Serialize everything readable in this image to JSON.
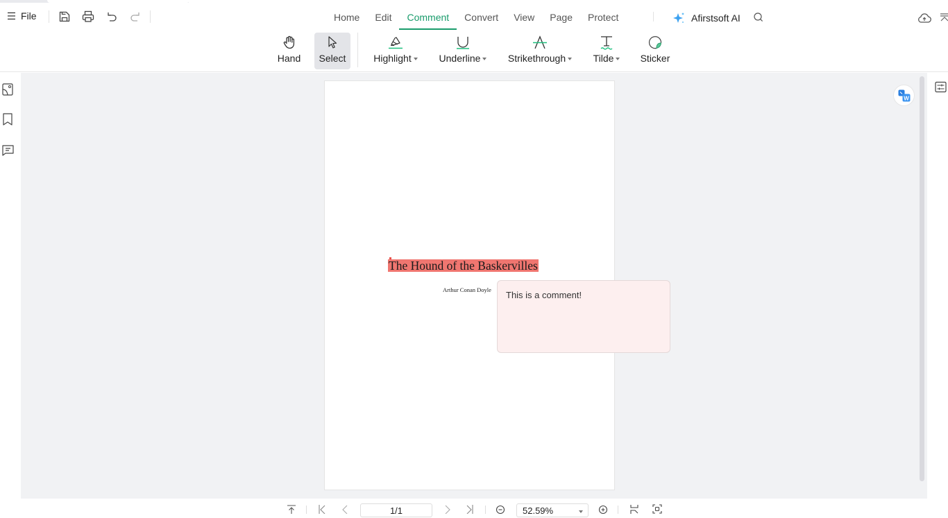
{
  "menubar": {
    "file_label": "File",
    "quick_actions": [
      "save-icon",
      "print-icon",
      "undo-icon",
      "redo-icon"
    ],
    "tabs": [
      {
        "label": "Home",
        "active": false
      },
      {
        "label": "Edit",
        "active": false
      },
      {
        "label": "Comment",
        "active": true
      },
      {
        "label": "Convert",
        "active": false
      },
      {
        "label": "View",
        "active": false
      },
      {
        "label": "Page",
        "active": false
      },
      {
        "label": "Protect",
        "active": false
      }
    ],
    "ai_label": "Afirstsoft AI",
    "accent_color": "#1a9c6c"
  },
  "toolbar": {
    "tools": [
      {
        "label": "Hand",
        "icon": "hand-icon",
        "dropdown": false,
        "active": false
      },
      {
        "label": "Select",
        "icon": "cursor-icon",
        "dropdown": false,
        "active": true
      },
      {
        "label": "Highlight",
        "icon": "highlighter-icon",
        "dropdown": true,
        "active": false
      },
      {
        "label": "Underline",
        "icon": "underline-icon",
        "dropdown": true,
        "active": false
      },
      {
        "label": "Strikethrough",
        "icon": "strikethrough-icon",
        "dropdown": true,
        "active": false
      },
      {
        "label": "Tilde",
        "icon": "tilde-icon",
        "dropdown": true,
        "active": false
      },
      {
        "label": "Sticker",
        "icon": "sticker-icon",
        "dropdown": false,
        "active": false
      }
    ]
  },
  "document": {
    "title": "The Hound of the Baskervilles",
    "author": "Arthur Conan Doyle",
    "highlight_color": "#f07670"
  },
  "comment": {
    "text": "This is a comment!",
    "background": "#fdefef"
  },
  "statusbar": {
    "page_value": "1/1",
    "zoom_value": "52.59%"
  }
}
